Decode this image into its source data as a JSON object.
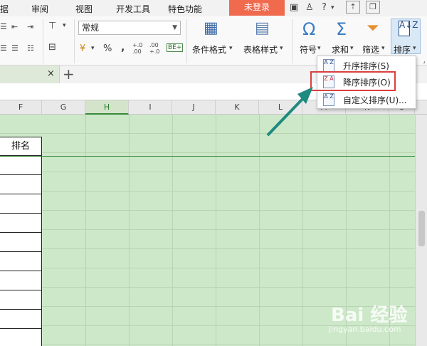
{
  "menu": {
    "tabs": [
      "据",
      "审阅",
      "视图",
      "开发工具",
      "特色功能"
    ],
    "login": "未登录",
    "help": "?",
    "icons": [
      "skin-icon",
      "shirt-icon",
      "help-icon",
      "upload-icon",
      "restore-icon"
    ]
  },
  "ribbon": {
    "number_format": "常规",
    "percent": "%",
    "comma": ",",
    "inc_decimal": "+.0 .00",
    "dec_decimal": ".00 +.0",
    "cond_format": "条件格式",
    "table_style": "表格样式",
    "symbol": "符号",
    "sum": "求和",
    "filter": "筛选",
    "sort": "排序"
  },
  "sheet_tabs": {
    "close": "×",
    "add": "+"
  },
  "columns": [
    "F",
    "G",
    "H",
    "I",
    "J",
    "K",
    "L",
    "M",
    "N",
    "O"
  ],
  "active_column": "H",
  "cells": {
    "f_header": "排名"
  },
  "sort_menu": {
    "items": [
      {
        "label": "升序排序(S)",
        "icon_text": "A Z"
      },
      {
        "label": "降序排序(O)",
        "icon_text": "Z A"
      },
      {
        "label": "自定义排序(U)...",
        "icon_text": "A Z"
      }
    ]
  },
  "watermark": {
    "brand": "Bai 经验",
    "url": "jingyan.baidu.com"
  },
  "colors": {
    "sheet_bg": "#cde8c9",
    "login_bg": "#f06a4e",
    "highlight": "#d94040",
    "arrow": "#1f8a80",
    "active_column": "#3a8a3a"
  }
}
